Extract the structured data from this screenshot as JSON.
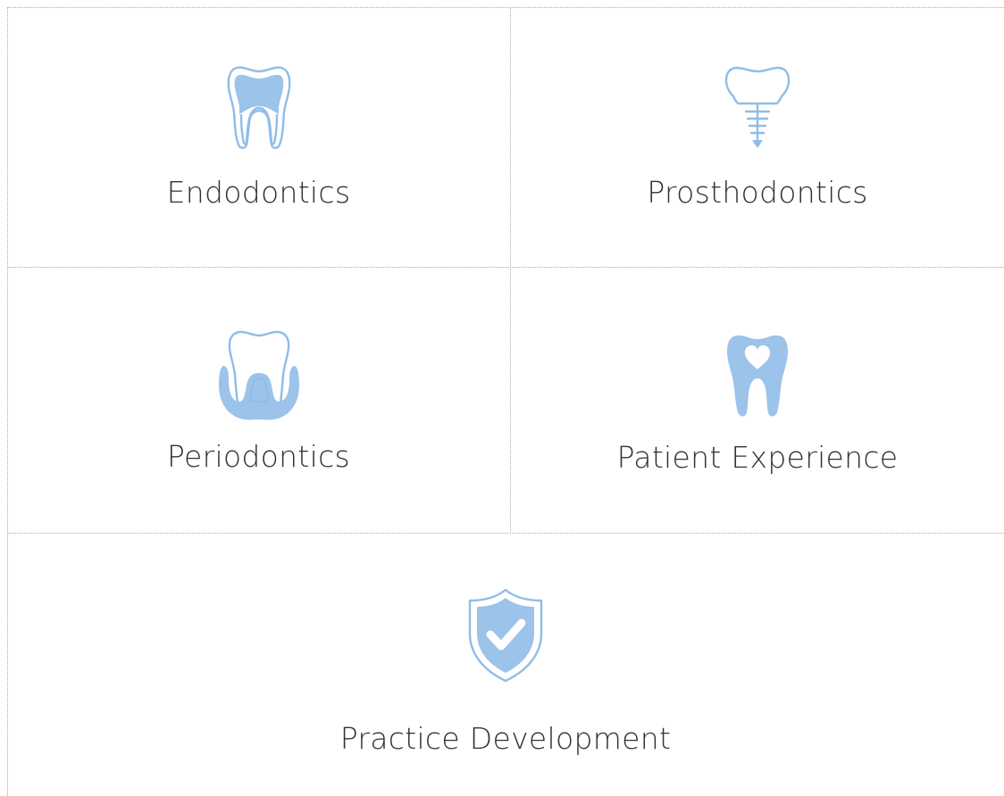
{
  "colors": {
    "icon_fill": "#9cc3e9",
    "icon_stroke": "#8fbde8",
    "divider": "#a9a9a9",
    "text": "#2e3236"
  },
  "categories": [
    {
      "label": "Endodontics",
      "icon": "tooth-root-canal-icon"
    },
    {
      "label": "Prosthodontics",
      "icon": "dental-implant-icon"
    },
    {
      "label": "Periodontics",
      "icon": "tooth-gum-icon"
    },
    {
      "label": "Patient Experience",
      "icon": "tooth-heart-icon"
    },
    {
      "label": "Practice Development",
      "icon": "shield-check-icon"
    }
  ]
}
